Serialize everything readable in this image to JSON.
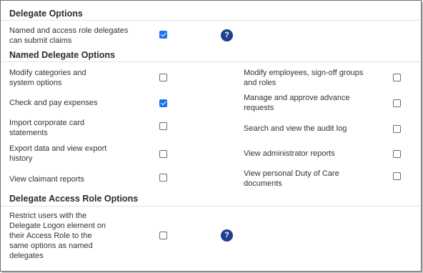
{
  "sections": {
    "delegate_options": {
      "title": "Delegate Options",
      "items": [
        {
          "label": "Named and access role delegates can submit claims",
          "checked": true
        }
      ]
    },
    "named_delegate_options": {
      "title": "Named Delegate Options",
      "left": [
        {
          "label": "Modify categories and system options",
          "checked": false
        },
        {
          "label": "Check and pay expenses",
          "checked": true
        },
        {
          "label": "Import corporate card statements",
          "checked": false
        },
        {
          "label": "Export data and view export history",
          "checked": false
        },
        {
          "label": "View claimant reports",
          "checked": false
        }
      ],
      "right": [
        {
          "label": "Modify employees, sign-off groups and roles",
          "checked": false
        },
        {
          "label": "Manage and approve advance requests",
          "checked": false
        },
        {
          "label": "Search and view the audit log",
          "checked": false
        },
        {
          "label": "View administrator reports",
          "checked": false
        },
        {
          "label": "View personal Duty of Care documents",
          "checked": false
        }
      ]
    },
    "delegate_access_role_options": {
      "title": "Delegate Access Role Options",
      "items": [
        {
          "label": "Restrict users with the Delegate Logon element on their Access Role to the same options as named delegates",
          "checked": false
        }
      ]
    }
  },
  "help_icon": {
    "glyph": "?",
    "icon": "help-icon"
  },
  "colors": {
    "accent": "#1a73e8",
    "help_bg": "#1f3f8f"
  }
}
